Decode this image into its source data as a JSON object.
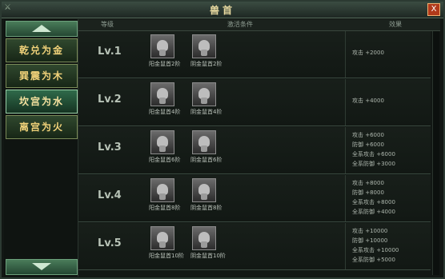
{
  "window": {
    "title": "兽首",
    "close_label": "X",
    "corner_label": "⚔"
  },
  "sidebar": {
    "tabs": [
      {
        "label": "乾兑为金"
      },
      {
        "label": "巽震为木"
      },
      {
        "label": "坎宫为水"
      },
      {
        "label": "离宫为火"
      }
    ]
  },
  "table": {
    "headers": [
      "等级",
      "激活条件",
      "效果"
    ],
    "rows": [
      {
        "level": "Lv.1",
        "items": [
          "阳金鼠首2阶",
          "阴金鼠首2阶"
        ],
        "effects": [
          "攻击 +2000"
        ]
      },
      {
        "level": "Lv.2",
        "items": [
          "阳金鼠首4阶",
          "阴金鼠首4阶"
        ],
        "effects": [
          "攻击 +4000"
        ]
      },
      {
        "level": "Lv.3",
        "items": [
          "阳金鼠首6阶",
          "阴金鼠首6阶"
        ],
        "effects": [
          "攻击 +6000",
          "防御 +6000",
          "全系攻击 +6000",
          "全系防御 +3000"
        ]
      },
      {
        "level": "Lv.4",
        "items": [
          "阳金鼠首8阶",
          "阴金鼠首8阶"
        ],
        "effects": [
          "攻击 +8000",
          "防御 +8000",
          "全系攻击 +8000",
          "全系防御 +4000"
        ]
      },
      {
        "level": "Lv.5",
        "items": [
          "阳金鼠首10阶",
          "阴金鼠首10阶"
        ],
        "effects": [
          "攻击 +10000",
          "防御 +10000",
          "全系攻击 +10000",
          "全系防御 +5000"
        ]
      }
    ]
  }
}
